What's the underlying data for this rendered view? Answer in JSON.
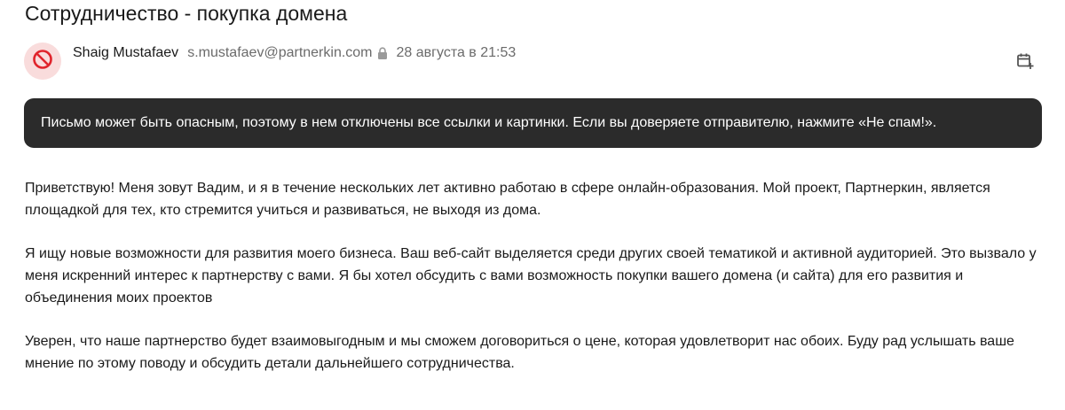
{
  "email": {
    "subject": "Сотрудничество - покупка домена",
    "sender_name": "Shaig Mustafaev",
    "sender_email": "s.mustafaev@partnerkin.com",
    "sent_date": "28 августа в 21:53",
    "avatar_icon": "blocked-icon",
    "warning_text": "Письмо может быть опасным, поэтому в нем отключены все ссылки и картинки. Если вы доверяете отправителю, нажмите «Не спам!».",
    "paragraphs": [
      "Приветствую! Меня зовут Вадим, и я в течение нескольких лет активно работаю в сфере онлайн-образования. Мой проект, Партнеркин, является площадкой для тех, кто стремится учиться и развиваться, не выходя из дома.",
      "Я ищу новые возможности для развития моего бизнеса. Ваш веб-сайт выделяется среди других своей тематикой и активной аудиторией. Это вызвало у меня искренний интерес к партнерству с вами. Я бы хотел обсудить с вами возможность покупки вашего домена (и сайта) для его развития и объединения моих проектов",
      "Уверен, что наше партнерство будет взаимовыгодным и мы сможем договориться о цене, которая удовлетворит нас обоих. Буду рад услышать ваше мнение по этому поводу и обсудить детали дальнейшего сотрудничества."
    ]
  },
  "colors": {
    "avatar_bg": "#f9dcdc",
    "avatar_icon": "#e0242c",
    "banner_bg": "#2b2b2b",
    "muted_text": "#6b6b6b"
  }
}
